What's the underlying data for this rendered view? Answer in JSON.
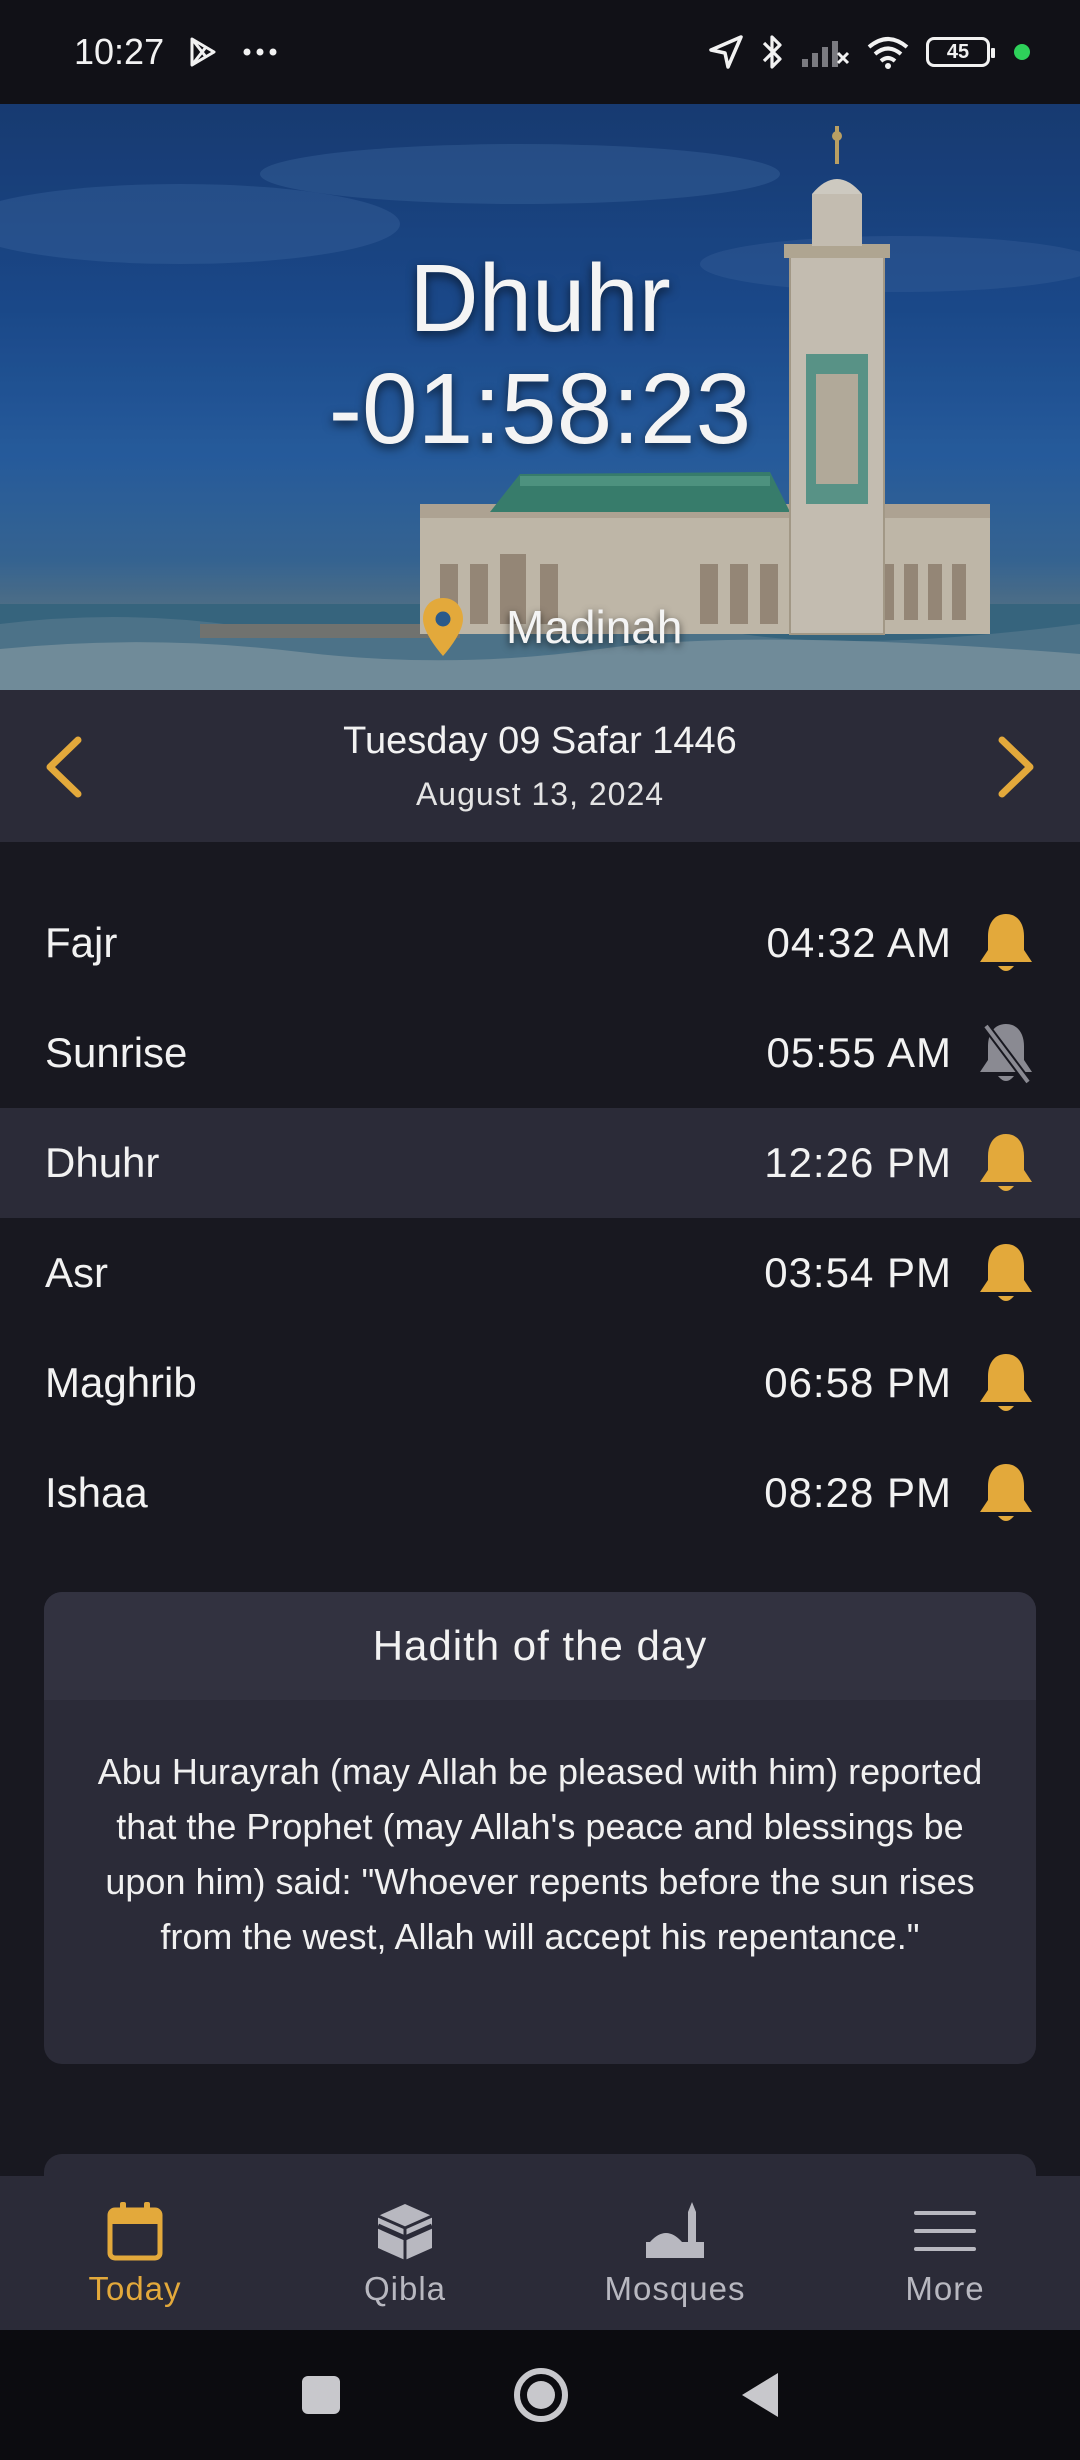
{
  "status_bar": {
    "time": "10:27",
    "battery": "45",
    "icons": [
      "play-store-icon",
      "more-dots-icon",
      "location-arrow-icon",
      "bluetooth-icon",
      "signal-icon",
      "wifi-icon",
      "battery-icon",
      "active-dot-icon"
    ]
  },
  "hero": {
    "prayer_name": "Dhuhr",
    "countdown": "-01:58:23",
    "location": "Madinah"
  },
  "date_bar": {
    "hijri": "Tuesday 09 Safar 1446",
    "gregorian": "August 13, 2024"
  },
  "prayers": [
    {
      "name": "Fajr",
      "time": "04:32 AM",
      "notify": true,
      "active": false
    },
    {
      "name": "Sunrise",
      "time": "05:55 AM",
      "notify": false,
      "active": false
    },
    {
      "name": "Dhuhr",
      "time": "12:26 PM",
      "notify": true,
      "active": true
    },
    {
      "name": "Asr",
      "time": "03:54 PM",
      "notify": true,
      "active": false
    },
    {
      "name": "Maghrib",
      "time": "06:58 PM",
      "notify": true,
      "active": false
    },
    {
      "name": "Ishaa",
      "time": "08:28 PM",
      "notify": true,
      "active": false
    }
  ],
  "hadith": {
    "title": "Hadith of the day",
    "text": "Abu Hurayrah (may Allah be pleased with him) reported that the Prophet (may Allah's peace and blessings be upon him) said: \"Whoever repents before the sun rises from the west, Allah will accept his repentance.\""
  },
  "bottom_nav": [
    {
      "label": "Today",
      "icon": "calendar-icon",
      "active": true
    },
    {
      "label": "Qibla",
      "icon": "kaaba-icon",
      "active": false
    },
    {
      "label": "Mosques",
      "icon": "mosque-icon",
      "active": false
    },
    {
      "label": "More",
      "icon": "menu-icon",
      "active": false
    }
  ],
  "colors": {
    "accent": "#e3a93b",
    "background": "#181820",
    "surface": "#2b2b38",
    "muted_icon": "#b8b8c0"
  }
}
